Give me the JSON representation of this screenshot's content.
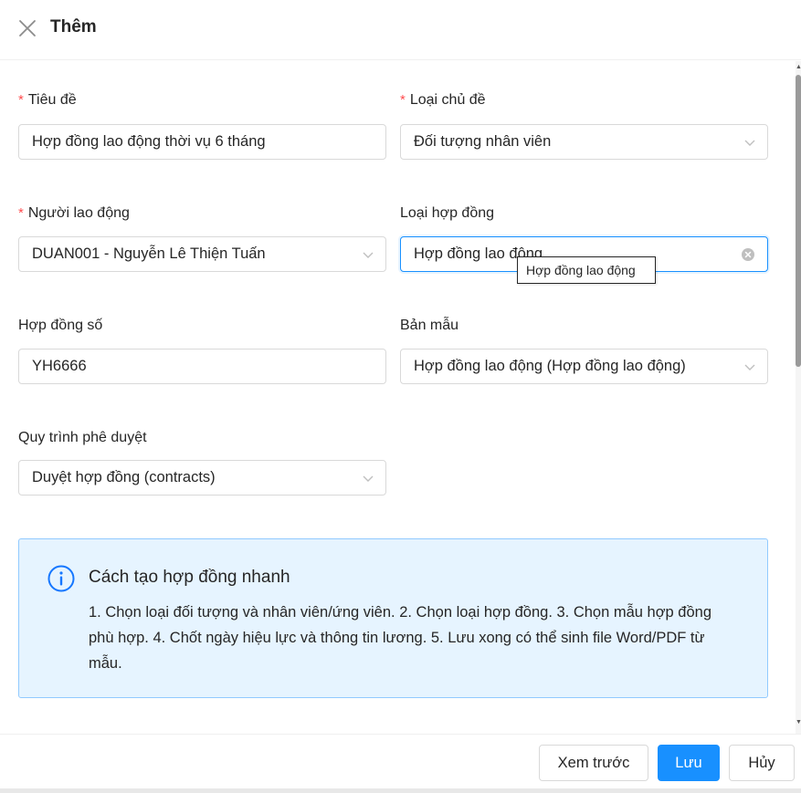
{
  "header": {
    "title": "Thêm"
  },
  "form": {
    "title_label": "Tiêu đề",
    "title_value": "Hợp đồng lao động thời vụ 6 tháng",
    "topic_type_label": "Loại chủ đề",
    "topic_type_value": "Đối tượng nhân viên",
    "employee_label": "Người lao động",
    "employee_value": "DUAN001 - Nguyễn Lê Thiện Tuấn",
    "contract_type_label": "Loại hợp đồng",
    "contract_type_value": "Hợp đồng lao động",
    "contract_type_tooltip": "Hợp đồng lao động",
    "contract_no_label": "Hợp đồng số",
    "contract_no_value": "YH6666",
    "template_label": "Bản mẫu",
    "template_value": "Hợp đồng lao động (Hợp đồng lao động)",
    "approval_label": "Quy trình phê duyệt",
    "approval_value": "Duyệt hợp đồng (contracts)",
    "required_mark": "*"
  },
  "info": {
    "title": "Cách tạo hợp đồng nhanh",
    "text": "1. Chọn loại đối tượng và nhân viên/ứng viên. 2. Chọn loại hợp đồng. 3. Chọn mẫu hợp đồng phù hợp. 4. Chốt ngày hiệu lực và thông tin lương. 5. Lưu xong có thể sinh file Word/PDF từ mẫu."
  },
  "footer": {
    "preview_label": "Xem trước",
    "save_label": "Lưu",
    "cancel_label": "Hủy"
  },
  "colors": {
    "primary": "#1890ff",
    "required": "#ff4d4f",
    "info_bg": "#e6f4ff",
    "info_border": "#91caff"
  },
  "icons": [
    "close-icon",
    "chevron-down-icon",
    "clear-icon",
    "info-icon"
  ]
}
